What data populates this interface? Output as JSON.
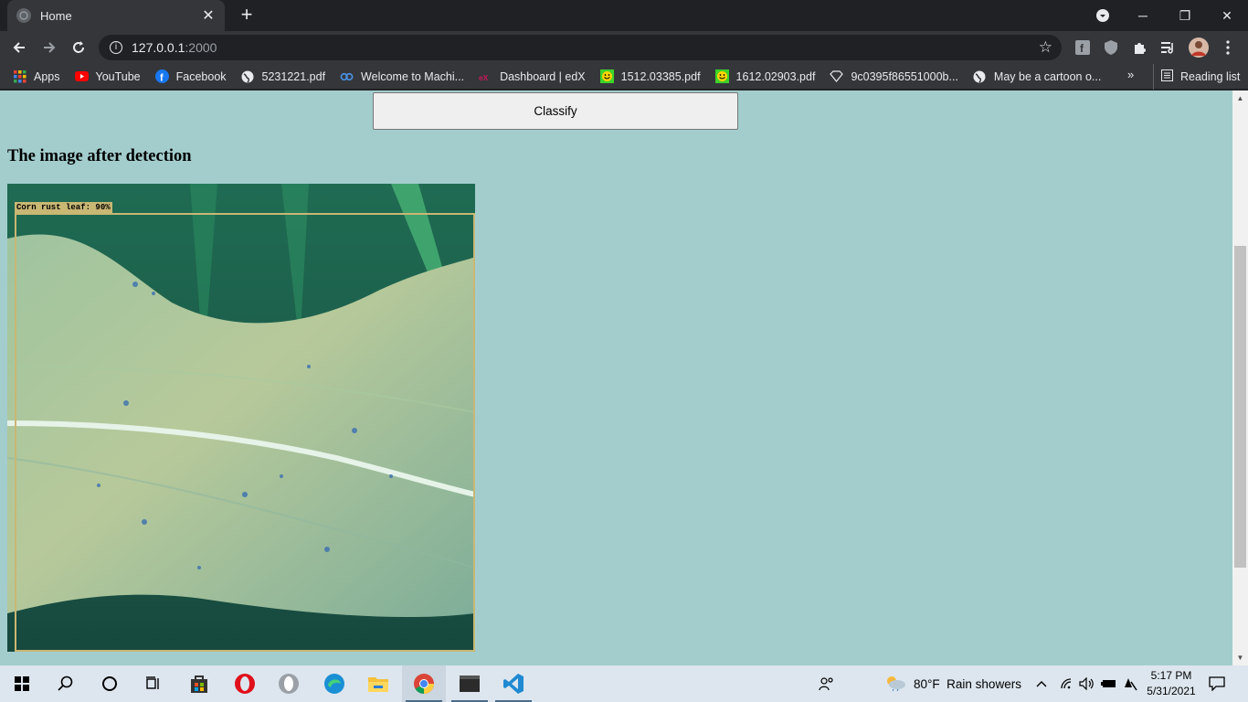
{
  "browser": {
    "tab_title": "Home",
    "url_host": "127.0.0.1",
    "url_port": ":2000"
  },
  "bookmarks": [
    {
      "label": "Apps",
      "icon": "apps-grid-icon",
      "color": "#ea4335"
    },
    {
      "label": "YouTube",
      "icon": "youtube-icon",
      "color": "#ff0000"
    },
    {
      "label": "Facebook",
      "icon": "facebook-icon",
      "color": "#1877f2"
    },
    {
      "label": "5231221.pdf",
      "icon": "globe-icon",
      "color": "#e8eaed"
    },
    {
      "label": "Welcome to Machi...",
      "icon": "coursera-icon",
      "color": "#4a90e2"
    },
    {
      "label": "Dashboard | edX",
      "icon": "edx-icon",
      "color": "#c81a5a"
    },
    {
      "label": "1512.03385.pdf",
      "icon": "smiley-icon",
      "color": "#3cd22a"
    },
    {
      "label": "1612.02903.pdf",
      "icon": "smiley-icon",
      "color": "#3cd22a"
    },
    {
      "label": "9c0395f86551000b...",
      "icon": "diamond-icon",
      "color": "#e8eaed"
    },
    {
      "label": "May be a cartoon o...",
      "icon": "globe-icon",
      "color": "#e8eaed"
    }
  ],
  "reading_list_label": "Reading list",
  "page": {
    "classify_label": "Classify",
    "heading": "The image after detection",
    "detection_label": "Corn rust leaf: 90%",
    "background_color": "#a3cdcd"
  },
  "taskbar": {
    "weather": "80°F  Rain showers",
    "time": "5:17 PM",
    "date": "5/31/2021"
  }
}
